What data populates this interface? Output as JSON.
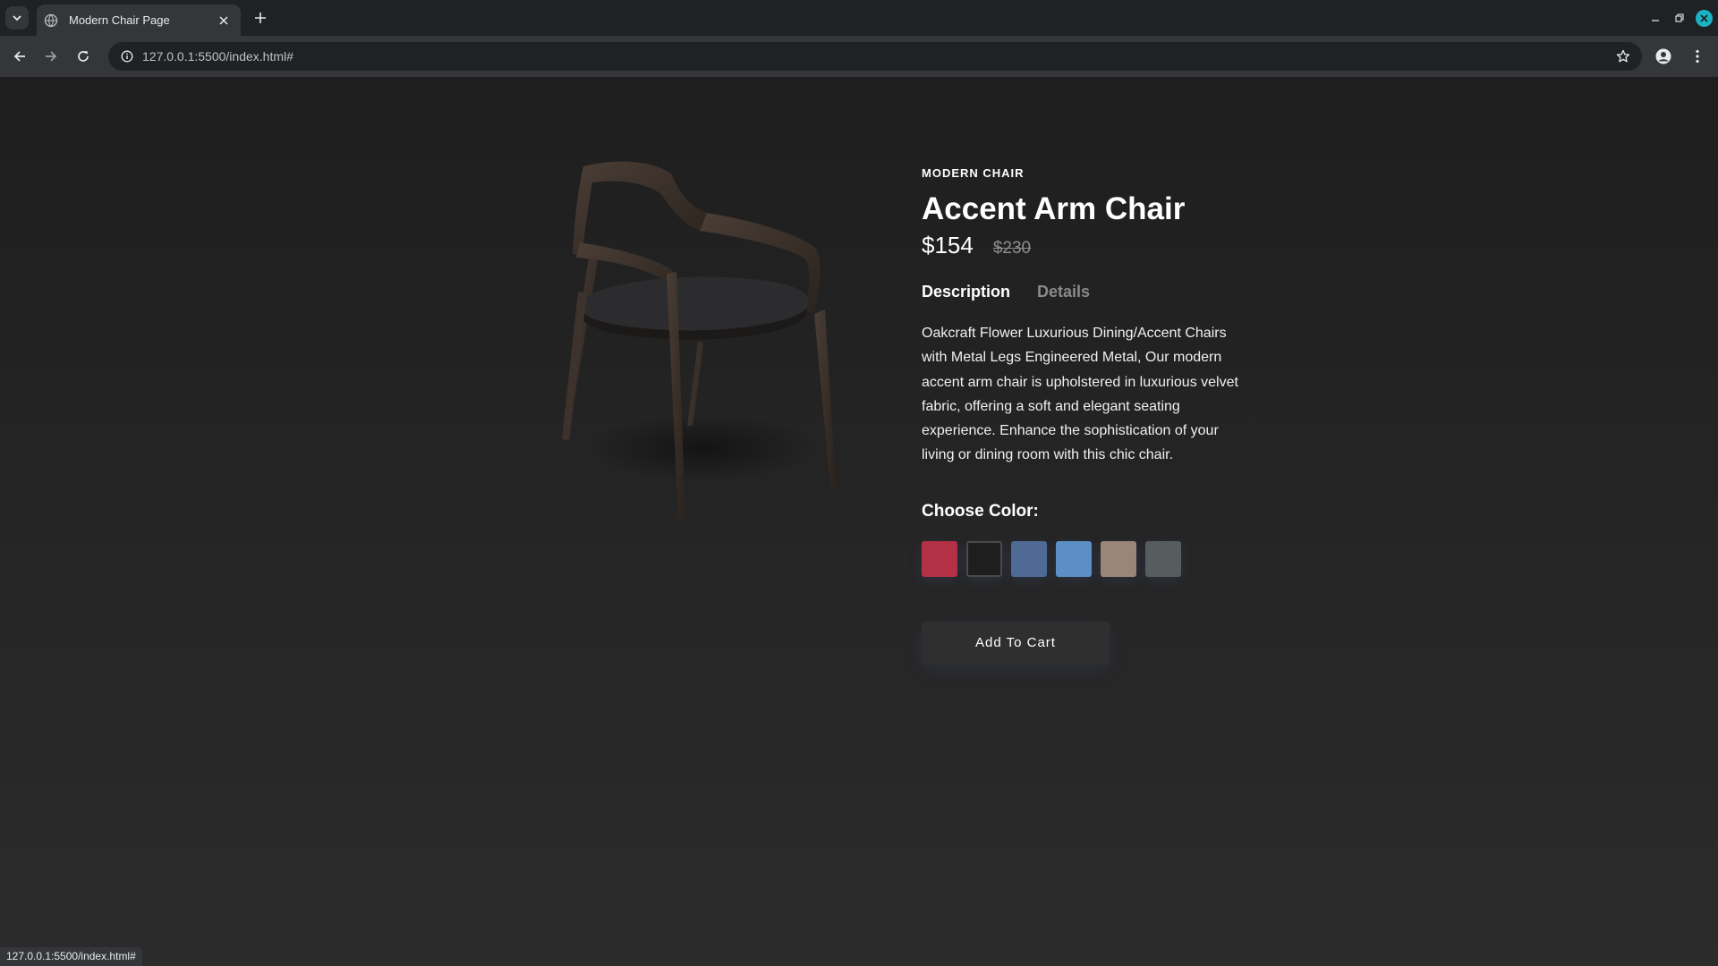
{
  "browser": {
    "tab_title": "Modern Chair Page",
    "url": "127.0.0.1:5500/index.html#",
    "status_url": "127.0.0.1:5500/index.html#"
  },
  "product": {
    "category": "MODERN CHAIR",
    "title": "Accent Arm Chair",
    "price": "$154",
    "old_price": "$230",
    "tabs": [
      {
        "label": "Description",
        "active": true
      },
      {
        "label": "Details",
        "active": false
      }
    ],
    "description": "Oakcraft Flower Luxurious Dining/Accent Chairs with Metal Legs Engineered Metal, Our modern accent arm chair is upholstered in luxurious velvet fabric, offering a soft and elegant seating experience. Enhance the sophistication of your living or dining room with this chic chair.",
    "color_label": "Choose Color:",
    "colors": [
      {
        "name": "red",
        "hex": "#b33045"
      },
      {
        "name": "black",
        "hex": "#1e1e1e",
        "selected": true
      },
      {
        "name": "denim",
        "hex": "#4f6a94"
      },
      {
        "name": "blue",
        "hex": "#5d8fc7"
      },
      {
        "name": "taupe",
        "hex": "#9b8578"
      },
      {
        "name": "gray",
        "hex": "#575d5e"
      }
    ],
    "cart_label": "Add To Cart"
  },
  "icons": {
    "tab_search": "chevron-down-icon",
    "favicon": "globe-icon",
    "tab_close": "close-icon",
    "new_tab": "plus-icon",
    "back": "arrow-left-icon",
    "forward": "arrow-right-icon",
    "reload": "reload-icon",
    "site_info": "info-icon",
    "bookmark": "star-icon",
    "profile": "person-icon",
    "menu": "kebab-menu-icon"
  }
}
